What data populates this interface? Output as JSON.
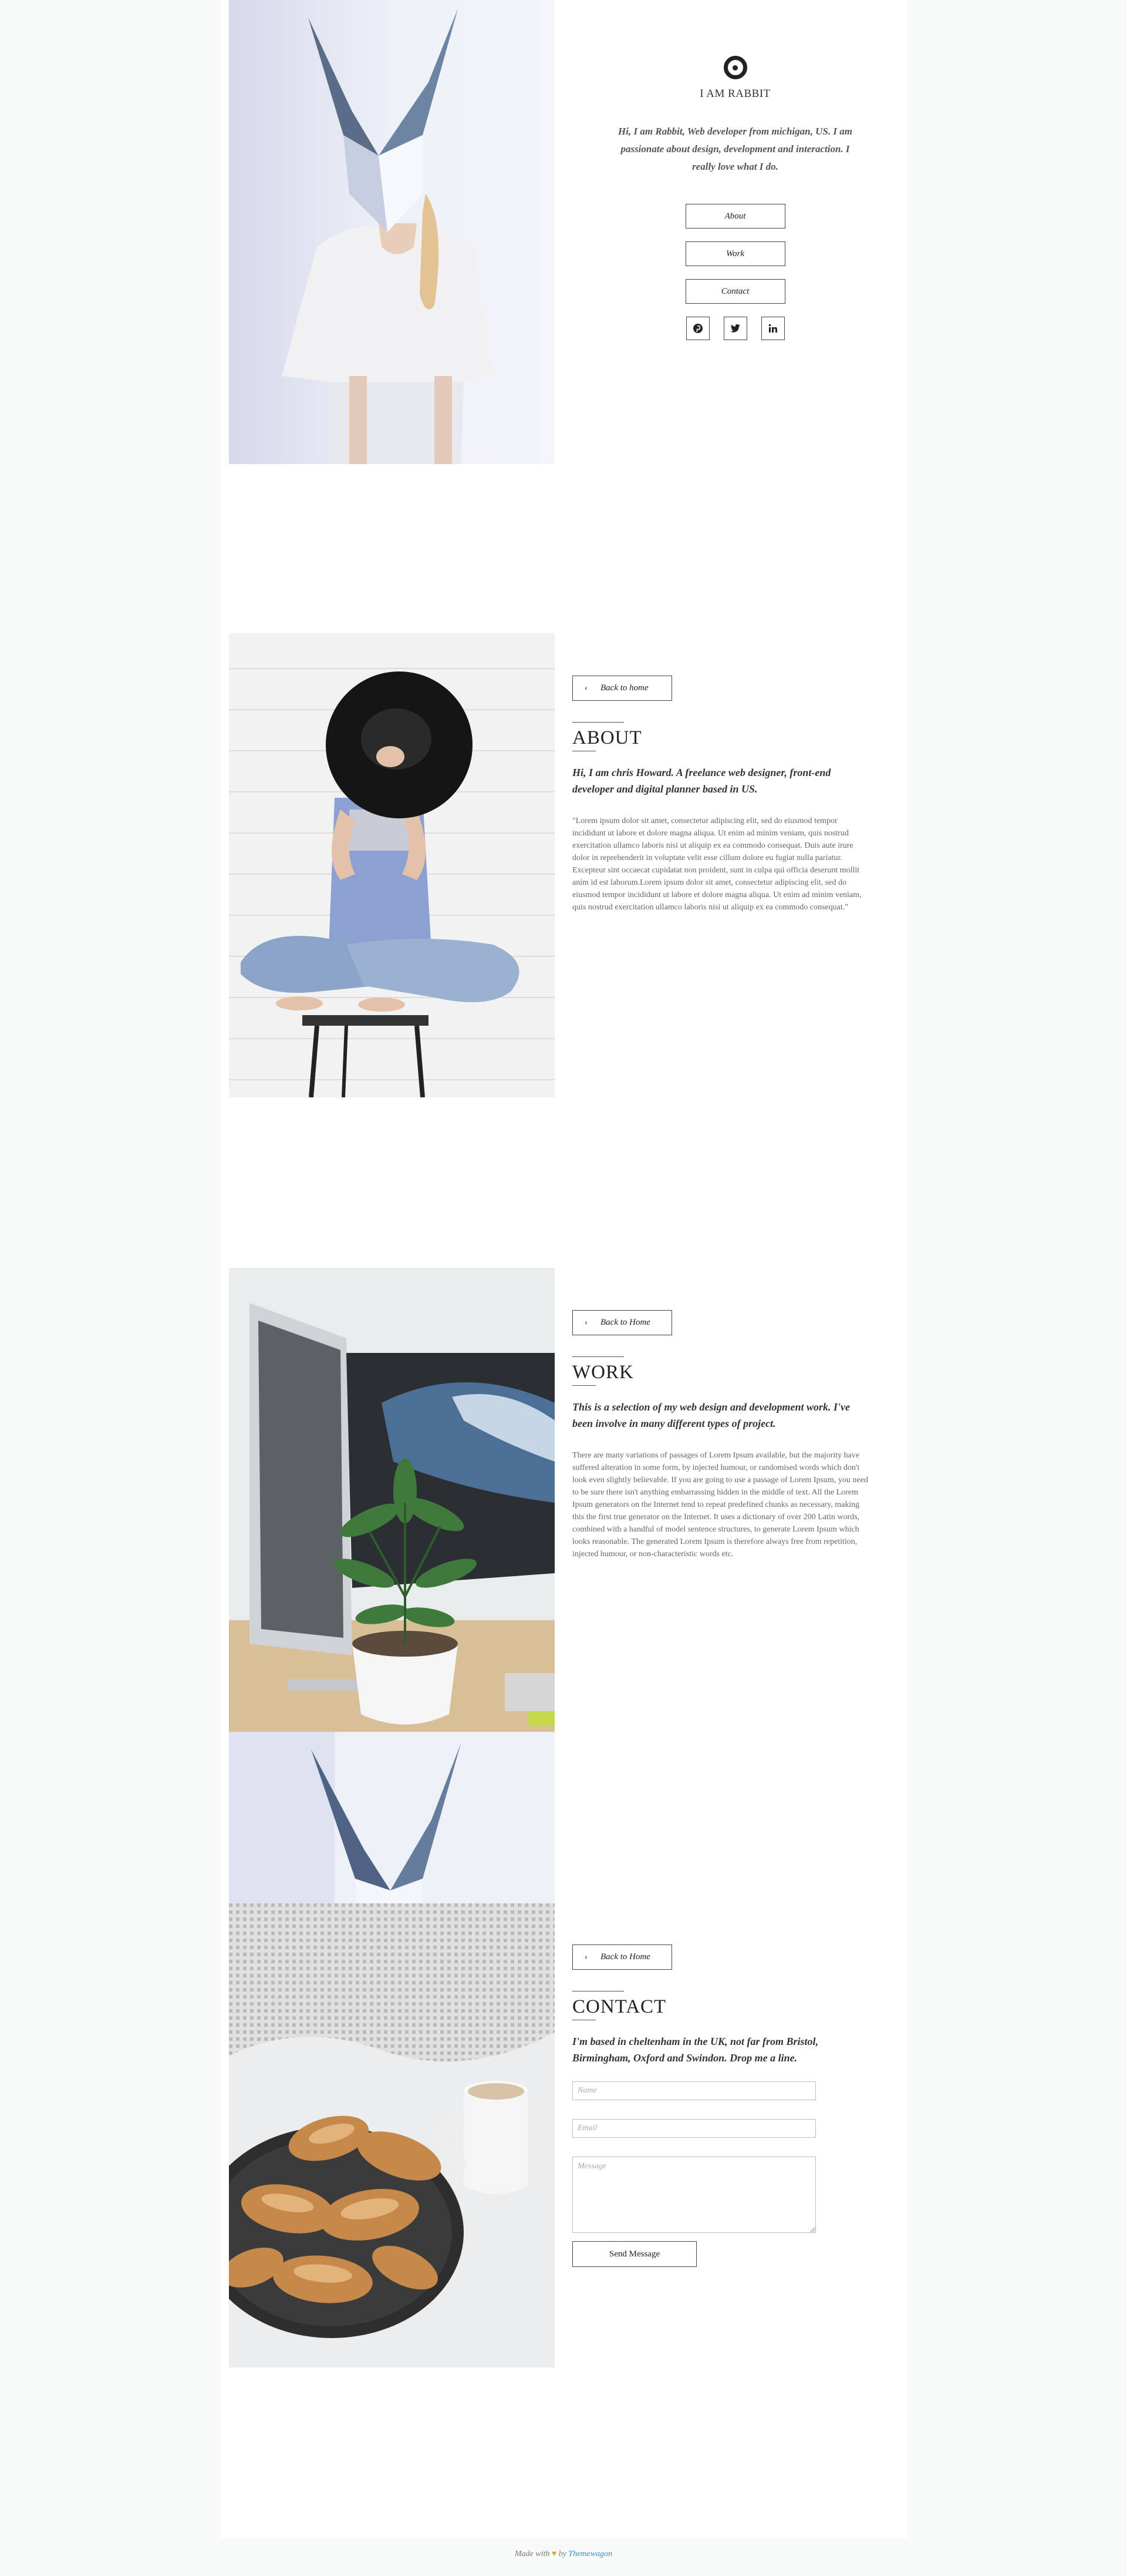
{
  "site": {
    "title": "I AM RABBIT",
    "intro": "Hi, I am Rabbit, Web developer from michigan, US. I am passionate about design, development and interaction. I really love what I do."
  },
  "menu": [
    {
      "label": "About"
    },
    {
      "label": "Work"
    },
    {
      "label": "Contact"
    }
  ],
  "social": [
    {
      "icon": "pinterest-icon"
    },
    {
      "icon": "twitter-icon"
    },
    {
      "icon": "linkedin-icon"
    }
  ],
  "about": {
    "back_label": "Back to home",
    "title": "ABOUT",
    "lead": "Hi, I am chris Howard. A freelance web designer, front-end developer and digital planner based in US.",
    "body": "\"Lorem ipsum dolor sit amet, consectetur adipiscing elit, sed do eiusmod tempor incididunt ut labore et dolore magna aliqua. Ut enim ad minim veniam, quis nostrud exercitation ullamco laboris nisi ut aliquip ex ea commodo consequat. Duis aute irure dolor in reprehenderit in voluptate velit esse cillum dolore eu fugiat nulla pariatur. Excepteur sint occaecat cupidatat non proident, sunt in culpa qui officia deserunt mollit anim id est laborum.Lorem ipsum dolor sit amet, consectetur adipiscing elit, sed do eiusmod tempor incididunt ut labore et dolore magna aliqua. Ut enim ad minim veniam, quis nostrud exercitation ullamco laboris nisi ut aliquip ex ea commodo consequat.\""
  },
  "work": {
    "back_label": "Back to Home",
    "title": "WORK",
    "lead": "This is a selection of my web design and development work. I've been involve in many different types of project.",
    "body": "There are many variations of passages of Lorem Ipsum available, but the majority have suffered alteration in some form, by injected humour, or randomised words which don't look even slightly believable. If you are going to use a passage of Lorem Ipsum, you need to be sure there isn't anything embarrassing hidden in the middle of text. All the Lorem Ipsum generators on the Internet tend to repeat predefined chunks as necessary, making this the first true generator on the Internet. It uses a dictionary of over 200 Latin words, combined with a handful of model sentence structures, to generate Lorem Ipsum which looks reasonable. The generated Lorem Ipsum is therefore always free from repetition, injected humour, or non-characteristic words etc."
  },
  "contact": {
    "back_label": "Back to Home",
    "title": "CONTACT",
    "lead": "I'm based in cheltenham in the UK, not far from Bristol, Birmingham, Oxford and Swindon. Drop me a line.",
    "name_placeholder": "Name",
    "email_placeholder": "Email",
    "message_placeholder": "Message",
    "send_label": "Send Message"
  },
  "footer": {
    "prefix": "Made with",
    "by": "by",
    "link": "Themewagon"
  },
  "colors": {
    "page_bg": "#f8f9f9",
    "card_bg": "#ffffff",
    "link": "#3b8bd0"
  }
}
